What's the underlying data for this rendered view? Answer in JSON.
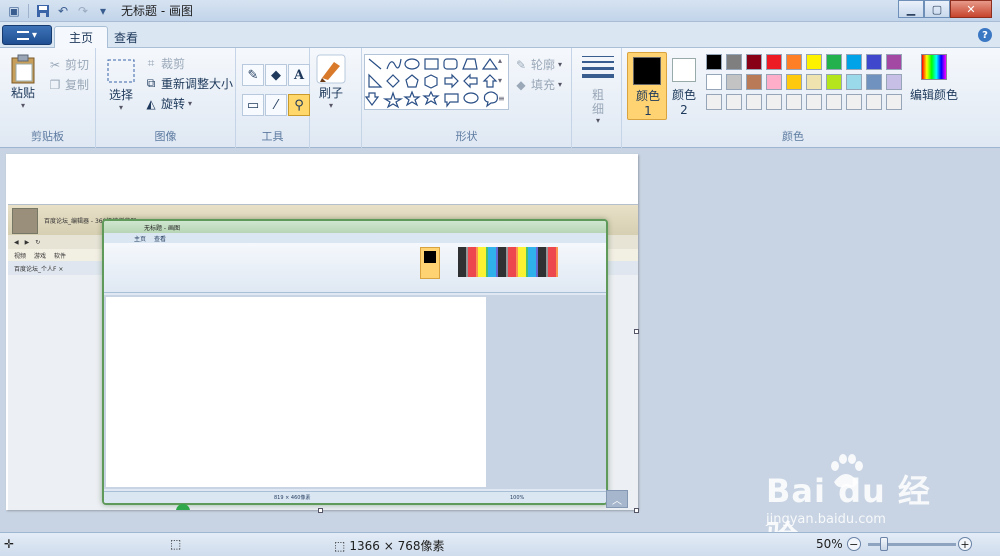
{
  "titlebar": {
    "title": "无标题 - 画图"
  },
  "tabs": {
    "menu_label": "▾",
    "home": "主页",
    "view": "查看",
    "help": "?"
  },
  "clipboard": {
    "paste": "粘贴",
    "cut": "剪切",
    "copy": "复制",
    "label": "剪贴板"
  },
  "image": {
    "select": "选择",
    "crop": "裁剪",
    "resize": "重新调整大小",
    "rotate": "旋转",
    "label": "图像"
  },
  "tools": {
    "label": "工具"
  },
  "brush": {
    "label": "刷子"
  },
  "shapes": {
    "outline": "轮廓",
    "fill": "填充",
    "label": "形状"
  },
  "size": {
    "label": "粗细"
  },
  "colors": {
    "color1": "颜色 1",
    "color2": "颜色 2",
    "edit": "编辑颜色",
    "label": "颜色",
    "palette": [
      "#000000",
      "#7f7f7f",
      "#880015",
      "#ed1c24",
      "#ff7f27",
      "#fff200",
      "#22b14c",
      "#00a2e8",
      "#3f48cc",
      "#a349a4",
      "#ffffff",
      "#c3c3c3",
      "#b97a57",
      "#ffaec9",
      "#ffc90e",
      "#efe4b0",
      "#b5e61d",
      "#99d9ea",
      "#7092be",
      "#c8bfe7",
      "#f0f0f0",
      "#f0f0f0",
      "#f0f0f0",
      "#f0f0f0",
      "#f0f0f0",
      "#f0f0f0",
      "#f0f0f0",
      "#f0f0f0",
      "#f0f0f0",
      "#f0f0f0"
    ]
  },
  "canvas_content": {
    "browser_title": "百度论坛_编辑器 - 360极速浏览器",
    "bookmarks": [
      "视频",
      "游戏",
      "软件"
    ],
    "browser_tab": "百度论坛_个人F ×",
    "inner_title": "无标题 - 画图",
    "inner_tab_home": "主页",
    "inner_tab_view": "查看",
    "inner_size": "819 × 460像素",
    "inner_zoom": "100%"
  },
  "statusbar": {
    "dimensions": "1366 × 768像素",
    "zoom": "50%",
    "minus": "−",
    "plus": "+"
  },
  "watermark": {
    "main": "Bai du 经验",
    "sub": "jingyan.baidu.com"
  }
}
